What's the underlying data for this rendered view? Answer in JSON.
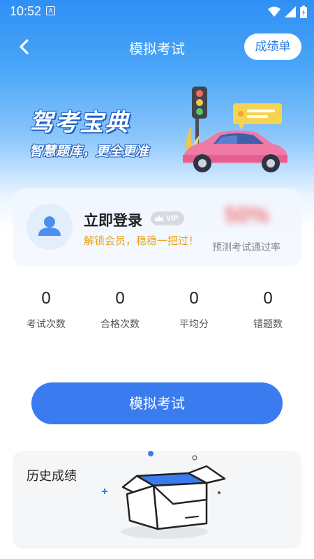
{
  "status_bar": {
    "time": "10:52",
    "notification_glyph": "A"
  },
  "nav": {
    "title": "模拟考试",
    "report_button": "成绩单"
  },
  "banner": {
    "title": "驾考宝典",
    "subtitle": "智慧题库，更全更准"
  },
  "login_card": {
    "title": "立即登录",
    "vip_label": "VIP",
    "subtitle": "解锁会员，稳稳一把过！",
    "pass_rate_value": "50%",
    "pass_rate_label": "预测考试通过率"
  },
  "stats": [
    {
      "value": "0",
      "label": "考试次数"
    },
    {
      "value": "0",
      "label": "合格次数"
    },
    {
      "value": "0",
      "label": "平均分"
    },
    {
      "value": "0",
      "label": "错题数"
    }
  ],
  "primary_button": "模拟考试",
  "history": {
    "title": "历史成绩"
  },
  "colors": {
    "accent": "#3a7cf0",
    "gold": "#e8a317"
  }
}
